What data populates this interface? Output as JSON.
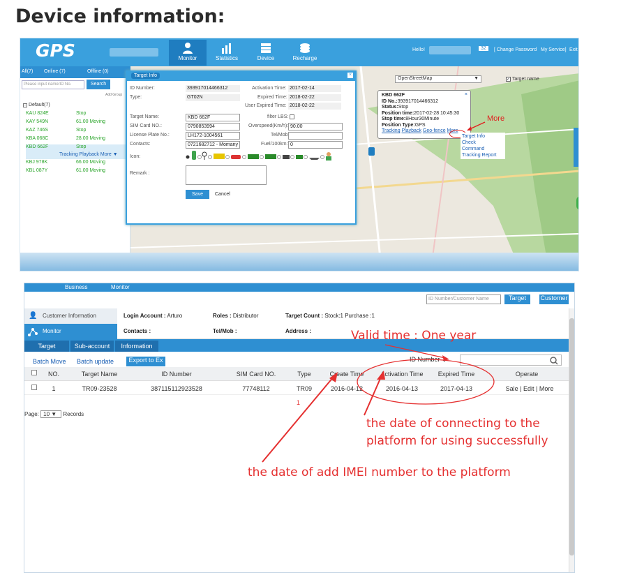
{
  "heading": "Device information:",
  "shot1": {
    "logo": "GPS",
    "nav": [
      "Monitor",
      "Statistics",
      "Device",
      "Recharge"
    ],
    "hello": "Hello!",
    "badge": "32",
    "change_password": "[ Change Password",
    "my_service": "My Service]",
    "exit": "Exit",
    "tabs": {
      "all": "All(7)",
      "online": "Online (7)",
      "offline": "Offline (0)"
    },
    "search_placeholder": "Please input name/ID No.",
    "search_button": "Search",
    "add_group": "Add Group",
    "group": "Default(7)",
    "vehicles": [
      {
        "name": "KAU 824E",
        "status": "Stop"
      },
      {
        "name": "KAY 549N",
        "status": "61.00  Moving"
      },
      {
        "name": "KAZ 746S",
        "status": "Stop"
      },
      {
        "name": "KBA 068C",
        "status": "28.00  Moving"
      },
      {
        "name": "KBD 662F",
        "status": "Stop"
      },
      {
        "name": "KBJ 978K",
        "status": "66.00  Moving"
      },
      {
        "name": "KBL 087Y",
        "status": "61.00  Moving"
      }
    ],
    "vehicle_links": "Tracking Playback More ▼",
    "map_select": "OpenStreetMap",
    "target_name_check": "Target name",
    "dialog": {
      "title": "Target Info",
      "id_number_label": "ID Number:",
      "id_number": "393917014466312",
      "type_label": "Type:",
      "type": "GT02N",
      "activation_label": "Activation Time:",
      "activation": "2017-02-14",
      "expired_label": "Expired Time:",
      "expired": "2018-02-22",
      "user_expired_label": "User Expired Time:",
      "user_expired": "2018-02-22",
      "target_name_label": "Target Name:",
      "target_name": "KBD 662F",
      "filter_lbs_label": "filter LBS:",
      "sim_label": "SIM Card NO.:",
      "sim": "0790853994",
      "overspeed_label": "Overspeed(Km/h):",
      "overspeed": "90.00",
      "plate_label": "License Plate No.:",
      "plate": "LH172-1004561",
      "tel_label": "Tel/Mob:",
      "tel": "",
      "contacts_label": "Contacts:",
      "contacts": "0721682712 - Momany",
      "fuel_label": "Fuel/100km:",
      "fuel": "0",
      "icon_label": "Icon:",
      "remark_label": "Remark :",
      "save": "Save",
      "cancel": "Cancel"
    },
    "popup": {
      "name": "KBD 662F",
      "id_no_label": "ID No.:",
      "id_no": "393917014466312",
      "status_label": "Status:",
      "status": "Stop",
      "position_time_label": "Position time:",
      "position_time": "2017-02-28 10:45:30",
      "stop_time_label": "Stop time:",
      "stop_time": "8Hour30Minute",
      "position_type_label": "Position Type:",
      "position_type": "GPS",
      "links": [
        "Tracking",
        "Playback",
        "Geo-fence",
        "More"
      ]
    },
    "more_menu": [
      "Target Info",
      "Check",
      "Command",
      "Tracking Report"
    ],
    "more_annotation": "More"
  },
  "shot2": {
    "top_tabs": [
      "Business",
      "Monitor"
    ],
    "search_placeholder": "ID Number/Customer Name",
    "target_button": "Target",
    "customer_button": "Customer",
    "side": [
      "Customer Information",
      "Monitor"
    ],
    "login_account_label": "Login Account :",
    "login_account": "Arturo",
    "roles_label": "Roles :",
    "roles": "Distributor",
    "target_count_label": "Target Count :",
    "target_count": "Stock:1  Purchase :1",
    "contacts_label": "Contacts :",
    "telmob_label": "Tel/Mob :",
    "address_label": "Address :",
    "tabs": [
      "Target",
      "Sub-account",
      "Information"
    ],
    "batch_move": "Batch Move",
    "batch_update": "Batch update",
    "export": "Export to Ex",
    "filter_select": "ID Number",
    "columns": [
      "NO.",
      "Target Name",
      "ID Number",
      "SIM Card NO.",
      "Type",
      "Create Time",
      "Activation Time",
      "Expired Time",
      "Operate"
    ],
    "row": {
      "no": "1",
      "target_name": "TR09-23528",
      "id_number": "387115112923528",
      "sim": "77748112",
      "type": "TR09",
      "create_time": "2016-04-12",
      "activation_time": "2016-04-13",
      "expired_time": "2017-04-13",
      "operate": "Sale  |  Edit  |  More"
    },
    "page_number": "1",
    "page_label": "Page:",
    "page_size": "10",
    "records": "Records"
  },
  "annotations": {
    "valid_time": "Valid time : One year",
    "activation_note_1": "the date of connecting to the",
    "activation_note_2": "platform for using successfully",
    "create_note": "the date of add IMEI number to the platform"
  },
  "colors": {
    "accent": "#2e8fd2",
    "annotation": "#e53030",
    "online": "#2aa52a"
  }
}
